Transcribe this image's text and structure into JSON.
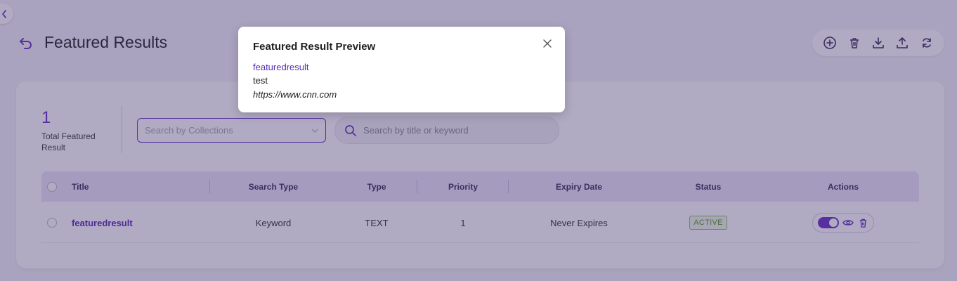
{
  "header": {
    "title": "Featured Results",
    "toolbar_icons": [
      "add-circle-icon",
      "trash-icon",
      "download-icon",
      "upload-icon",
      "refresh-icon"
    ]
  },
  "stats": {
    "total_value": "1",
    "total_label": "Total Featured Result"
  },
  "filters": {
    "collection_placeholder": "Search by Collections",
    "search_placeholder": "Search by title or keyword"
  },
  "table": {
    "columns": {
      "title": "Title",
      "search_type": "Search Type",
      "type": "Type",
      "priority": "Priority",
      "expiry_date": "Expiry Date",
      "status": "Status",
      "actions": "Actions"
    },
    "rows": [
      {
        "title": "featuredresult",
        "search_type": "Keyword",
        "type": "TEXT",
        "priority": "1",
        "expiry_date": "Never Expires",
        "status": "ACTIVE",
        "enabled": true
      }
    ]
  },
  "modal": {
    "title": "Featured Result Preview",
    "result_title": "featuredresult",
    "description": "test",
    "url": "https://www.cnn.com"
  },
  "colors": {
    "accent": "#6a35c2",
    "status_active": "#5c9a1e",
    "overlay": "#3a2a68"
  }
}
